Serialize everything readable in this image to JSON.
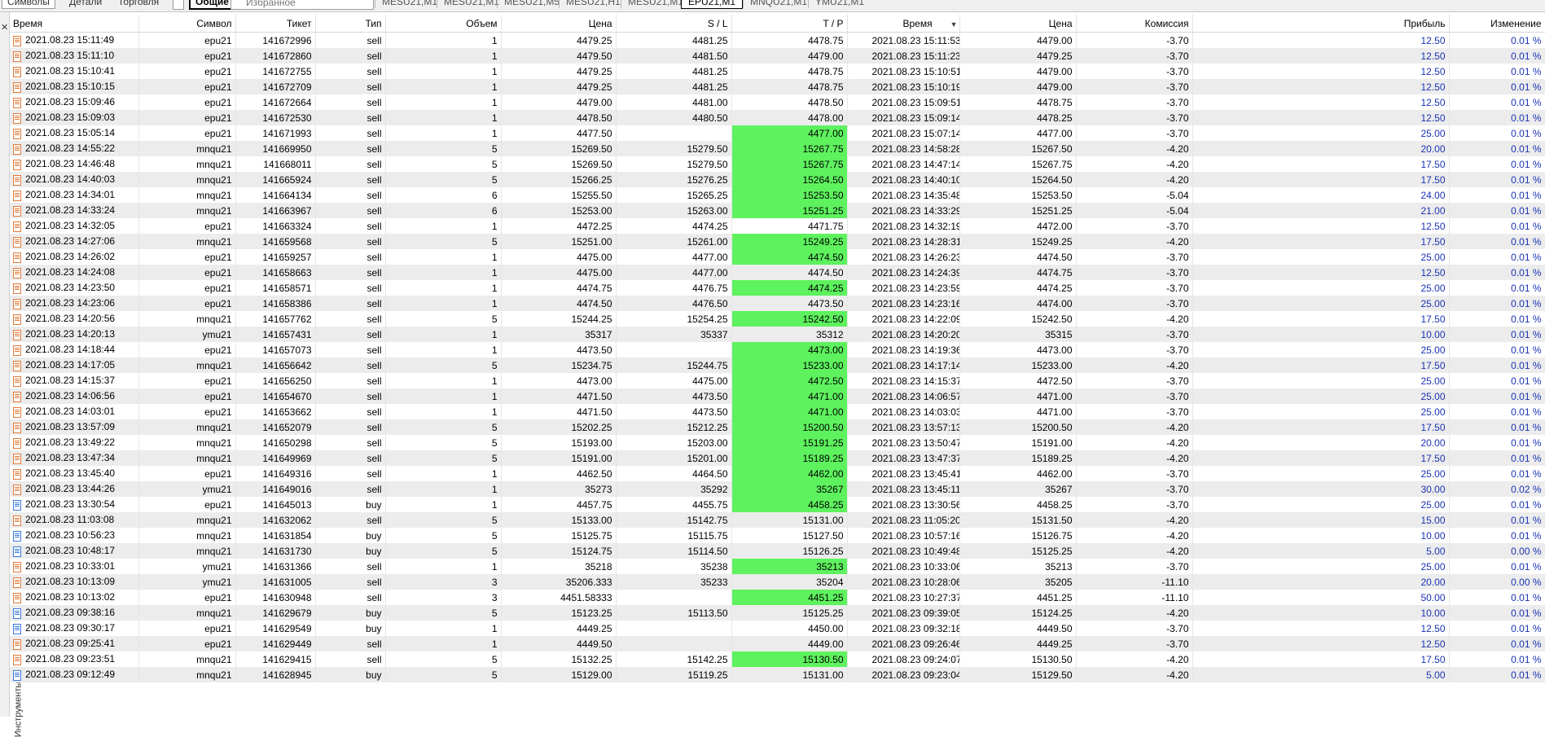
{
  "panel_tabs": [
    "Символы",
    "Детали",
    "Торговля",
    "Общие",
    "Избранное"
  ],
  "chart_tabs": [
    {
      "label": "MESU21,M1",
      "active": false
    },
    {
      "label": "MESU21,M1",
      "active": false
    },
    {
      "label": "MESU21,M5",
      "active": false
    },
    {
      "label": "MESU21,H1",
      "active": false
    },
    {
      "label": "MESU21,M1",
      "active": false
    },
    {
      "label": "EPU21,M1",
      "active": true
    },
    {
      "label": "MNQU21,M1",
      "active": false
    },
    {
      "label": "YMU21,M1",
      "active": false
    }
  ],
  "side_label": "Инструменты",
  "columns": [
    "Время",
    "Символ",
    "Тикет",
    "Тип",
    "Объем",
    "Цена",
    "S / L",
    "T / P",
    "Время",
    "Цена",
    "Комиссия",
    "Прибыль",
    "Изменение"
  ],
  "sort_icon": "sort-desc-icon",
  "colors": {
    "tp_hit": "#5ef25e",
    "profit_text": "#1a33b3",
    "row_alt": "#ececec"
  },
  "rows": [
    [
      "2021.08.23 15:11:49",
      "epu21",
      "141672996",
      "sell",
      "1",
      "4479.25",
      "4481.25",
      "4478.75",
      "2021.08.23 15:11:53",
      "4479.00",
      "-3.70",
      "12.50",
      "0.01 %",
      false
    ],
    [
      "2021.08.23 15:11:10",
      "epu21",
      "141672860",
      "sell",
      "1",
      "4479.50",
      "4481.50",
      "4479.00",
      "2021.08.23 15:11:23",
      "4479.25",
      "-3.70",
      "12.50",
      "0.01 %",
      false
    ],
    [
      "2021.08.23 15:10:41",
      "epu21",
      "141672755",
      "sell",
      "1",
      "4479.25",
      "4481.25",
      "4478.75",
      "2021.08.23 15:10:51",
      "4479.00",
      "-3.70",
      "12.50",
      "0.01 %",
      false
    ],
    [
      "2021.08.23 15:10:15",
      "epu21",
      "141672709",
      "sell",
      "1",
      "4479.25",
      "4481.25",
      "4478.75",
      "2021.08.23 15:10:19",
      "4479.00",
      "-3.70",
      "12.50",
      "0.01 %",
      false
    ],
    [
      "2021.08.23 15:09:46",
      "epu21",
      "141672664",
      "sell",
      "1",
      "4479.00",
      "4481.00",
      "4478.50",
      "2021.08.23 15:09:51",
      "4478.75",
      "-3.70",
      "12.50",
      "0.01 %",
      false
    ],
    [
      "2021.08.23 15:09:03",
      "epu21",
      "141672530",
      "sell",
      "1",
      "4478.50",
      "4480.50",
      "4478.00",
      "2021.08.23 15:09:14",
      "4478.25",
      "-3.70",
      "12.50",
      "0.01 %",
      false
    ],
    [
      "2021.08.23 15:05:14",
      "epu21",
      "141671993",
      "sell",
      "1",
      "4477.50",
      "",
      "4477.00",
      "2021.08.23 15:07:14",
      "4477.00",
      "-3.70",
      "25.00",
      "0.01 %",
      true
    ],
    [
      "2021.08.23 14:55:22",
      "mnqu21",
      "141669950",
      "sell",
      "5",
      "15269.50",
      "15279.50",
      "15267.75",
      "2021.08.23 14:58:28",
      "15267.50",
      "-4.20",
      "20.00",
      "0.01 %",
      true
    ],
    [
      "2021.08.23 14:46:48",
      "mnqu21",
      "141668011",
      "sell",
      "5",
      "15269.50",
      "15279.50",
      "15267.75",
      "2021.08.23 14:47:14",
      "15267.75",
      "-4.20",
      "17.50",
      "0.01 %",
      true
    ],
    [
      "2021.08.23 14:40:03",
      "mnqu21",
      "141665924",
      "sell",
      "5",
      "15266.25",
      "15276.25",
      "15264.50",
      "2021.08.23 14:40:10",
      "15264.50",
      "-4.20",
      "17.50",
      "0.01 %",
      true
    ],
    [
      "2021.08.23 14:34:01",
      "mnqu21",
      "141664134",
      "sell",
      "6",
      "15255.50",
      "15265.25",
      "15253.50",
      "2021.08.23 14:35:48",
      "15253.50",
      "-5.04",
      "24.00",
      "0.01 %",
      true
    ],
    [
      "2021.08.23 14:33:24",
      "mnqu21",
      "141663967",
      "sell",
      "6",
      "15253.00",
      "15263.00",
      "15251.25",
      "2021.08.23 14:33:29",
      "15251.25",
      "-5.04",
      "21.00",
      "0.01 %",
      true
    ],
    [
      "2021.08.23 14:32:05",
      "epu21",
      "141663324",
      "sell",
      "1",
      "4472.25",
      "4474.25",
      "4471.75",
      "2021.08.23 14:32:19",
      "4472.00",
      "-3.70",
      "12.50",
      "0.01 %",
      false
    ],
    [
      "2021.08.23 14:27:06",
      "mnqu21",
      "141659568",
      "sell",
      "5",
      "15251.00",
      "15261.00",
      "15249.25",
      "2021.08.23 14:28:31",
      "15249.25",
      "-4.20",
      "17.50",
      "0.01 %",
      true
    ],
    [
      "2021.08.23 14:26:02",
      "epu21",
      "141659257",
      "sell",
      "1",
      "4475.00",
      "4477.00",
      "4474.50",
      "2021.08.23 14:26:23",
      "4474.50",
      "-3.70",
      "25.00",
      "0.01 %",
      true
    ],
    [
      "2021.08.23 14:24:08",
      "epu21",
      "141658663",
      "sell",
      "1",
      "4475.00",
      "4477.00",
      "4474.50",
      "2021.08.23 14:24:39",
      "4474.75",
      "-3.70",
      "12.50",
      "0.01 %",
      false
    ],
    [
      "2021.08.23 14:23:50",
      "epu21",
      "141658571",
      "sell",
      "1",
      "4474.75",
      "4476.75",
      "4474.25",
      "2021.08.23 14:23:59",
      "4474.25",
      "-3.70",
      "25.00",
      "0.01 %",
      true
    ],
    [
      "2021.08.23 14:23:06",
      "epu21",
      "141658386",
      "sell",
      "1",
      "4474.50",
      "4476.50",
      "4473.50",
      "2021.08.23 14:23:16",
      "4474.00",
      "-3.70",
      "25.00",
      "0.01 %",
      false
    ],
    [
      "2021.08.23 14:20:56",
      "mnqu21",
      "141657762",
      "sell",
      "5",
      "15244.25",
      "15254.25",
      "15242.50",
      "2021.08.23 14:22:09",
      "15242.50",
      "-4.20",
      "17.50",
      "0.01 %",
      true
    ],
    [
      "2021.08.23 14:20:13",
      "ymu21",
      "141657431",
      "sell",
      "1",
      "35317",
      "35337",
      "35312",
      "2021.08.23 14:20:20",
      "35315",
      "-3.70",
      "10.00",
      "0.01 %",
      false
    ],
    [
      "2021.08.23 14:18:44",
      "epu21",
      "141657073",
      "sell",
      "1",
      "4473.50",
      "",
      "4473.00",
      "2021.08.23 14:19:36",
      "4473.00",
      "-3.70",
      "25.00",
      "0.01 %",
      true
    ],
    [
      "2021.08.23 14:17:05",
      "mnqu21",
      "141656642",
      "sell",
      "5",
      "15234.75",
      "15244.75",
      "15233.00",
      "2021.08.23 14:17:14",
      "15233.00",
      "-4.20",
      "17.50",
      "0.01 %",
      true
    ],
    [
      "2021.08.23 14:15:37",
      "epu21",
      "141656250",
      "sell",
      "1",
      "4473.00",
      "4475.00",
      "4472.50",
      "2021.08.23 14:15:37",
      "4472.50",
      "-3.70",
      "25.00",
      "0.01 %",
      true
    ],
    [
      "2021.08.23 14:06:56",
      "epu21",
      "141654670",
      "sell",
      "1",
      "4471.50",
      "4473.50",
      "4471.00",
      "2021.08.23 14:06:57",
      "4471.00",
      "-3.70",
      "25.00",
      "0.01 %",
      true
    ],
    [
      "2021.08.23 14:03:01",
      "epu21",
      "141653662",
      "sell",
      "1",
      "4471.50",
      "4473.50",
      "4471.00",
      "2021.08.23 14:03:03",
      "4471.00",
      "-3.70",
      "25.00",
      "0.01 %",
      true
    ],
    [
      "2021.08.23 13:57:09",
      "mnqu21",
      "141652079",
      "sell",
      "5",
      "15202.25",
      "15212.25",
      "15200.50",
      "2021.08.23 13:57:13",
      "15200.50",
      "-4.20",
      "17.50",
      "0.01 %",
      true
    ],
    [
      "2021.08.23 13:49:22",
      "mnqu21",
      "141650298",
      "sell",
      "5",
      "15193.00",
      "15203.00",
      "15191.25",
      "2021.08.23 13:50:47",
      "15191.00",
      "-4.20",
      "20.00",
      "0.01 %",
      true
    ],
    [
      "2021.08.23 13:47:34",
      "mnqu21",
      "141649969",
      "sell",
      "5",
      "15191.00",
      "15201.00",
      "15189.25",
      "2021.08.23 13:47:37",
      "15189.25",
      "-4.20",
      "17.50",
      "0.01 %",
      true
    ],
    [
      "2021.08.23 13:45:40",
      "epu21",
      "141649316",
      "sell",
      "1",
      "4462.50",
      "4464.50",
      "4462.00",
      "2021.08.23 13:45:41",
      "4462.00",
      "-3.70",
      "25.00",
      "0.01 %",
      true
    ],
    [
      "2021.08.23 13:44:26",
      "ymu21",
      "141649016",
      "sell",
      "1",
      "35273",
      "35292",
      "35267",
      "2021.08.23 13:45:11",
      "35267",
      "-3.70",
      "30.00",
      "0.02 %",
      true
    ],
    [
      "2021.08.23 13:30:54",
      "epu21",
      "141645013",
      "buy",
      "1",
      "4457.75",
      "4455.75",
      "4458.25",
      "2021.08.23 13:30:56",
      "4458.25",
      "-3.70",
      "25.00",
      "0.01 %",
      true
    ],
    [
      "2021.08.23 11:03:08",
      "mnqu21",
      "141632062",
      "sell",
      "5",
      "15133.00",
      "15142.75",
      "15131.00",
      "2021.08.23 11:05:20",
      "15131.50",
      "-4.20",
      "15.00",
      "0.01 %",
      false
    ],
    [
      "2021.08.23 10:56:23",
      "mnqu21",
      "141631854",
      "buy",
      "5",
      "15125.75",
      "15115.75",
      "15127.50",
      "2021.08.23 10:57:16",
      "15126.75",
      "-4.20",
      "10.00",
      "0.01 %",
      false
    ],
    [
      "2021.08.23 10:48:17",
      "mnqu21",
      "141631730",
      "buy",
      "5",
      "15124.75",
      "15114.50",
      "15126.25",
      "2021.08.23 10:49:48",
      "15125.25",
      "-4.20",
      "5.00",
      "0.00 %",
      false
    ],
    [
      "2021.08.23 10:33:01",
      "ymu21",
      "141631366",
      "sell",
      "1",
      "35218",
      "35238",
      "35213",
      "2021.08.23 10:33:06",
      "35213",
      "-3.70",
      "25.00",
      "0.01 %",
      true
    ],
    [
      "2021.08.23 10:13:09",
      "ymu21",
      "141631005",
      "sell",
      "3",
      "35206.333",
      "35233",
      "35204",
      "2021.08.23 10:28:06",
      "35205",
      "-11.10",
      "20.00",
      "0.00 %",
      false
    ],
    [
      "2021.08.23 10:13:02",
      "epu21",
      "141630948",
      "sell",
      "3",
      "4451.58333",
      "",
      "4451.25",
      "2021.08.23 10:27:37",
      "4451.25",
      "-11.10",
      "50.00",
      "0.01 %",
      true
    ],
    [
      "2021.08.23 09:38:16",
      "mnqu21",
      "141629679",
      "buy",
      "5",
      "15123.25",
      "15113.50",
      "15125.25",
      "2021.08.23 09:39:05",
      "15124.25",
      "-4.20",
      "10.00",
      "0.01 %",
      false
    ],
    [
      "2021.08.23 09:30:17",
      "epu21",
      "141629549",
      "buy",
      "1",
      "4449.25",
      "",
      "4450.00",
      "2021.08.23 09:32:18",
      "4449.50",
      "-3.70",
      "12.50",
      "0.01 %",
      false
    ],
    [
      "2021.08.23 09:25:41",
      "epu21",
      "141629449",
      "sell",
      "1",
      "4449.50",
      "",
      "4449.00",
      "2021.08.23 09:26:46",
      "4449.25",
      "-3.70",
      "12.50",
      "0.01 %",
      false
    ],
    [
      "2021.08.23 09:23:51",
      "mnqu21",
      "141629415",
      "sell",
      "5",
      "15132.25",
      "15142.25",
      "15130.50",
      "2021.08.23 09:24:07",
      "15130.50",
      "-4.20",
      "17.50",
      "0.01 %",
      true
    ],
    [
      "2021.08.23 09:12:49",
      "mnqu21",
      "141628945",
      "buy",
      "5",
      "15129.00",
      "15119.25",
      "15131.00",
      "2021.08.23 09:23:04",
      "15129.50",
      "-4.20",
      "5.00",
      "0.01 %",
      false
    ]
  ]
}
